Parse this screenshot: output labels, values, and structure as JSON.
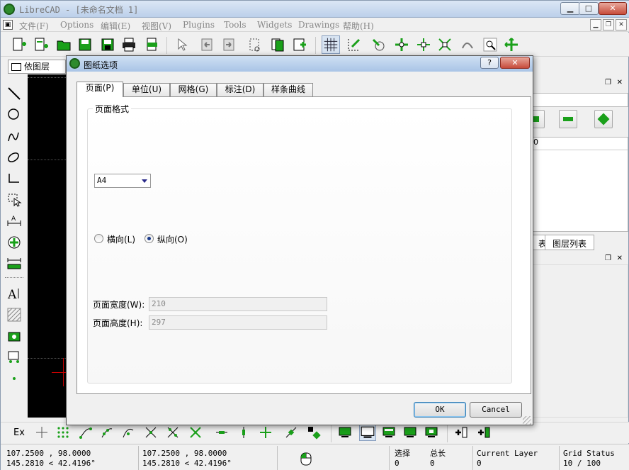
{
  "app": {
    "title": "LibreCAD - [未命名文档 1]"
  },
  "menu": {
    "items": [
      {
        "label": "文件(F)"
      },
      {
        "label": "Options"
      },
      {
        "label": "编辑(E)"
      },
      {
        "label": "视图(V)"
      },
      {
        "label": "Plugins"
      },
      {
        "label": "Tools"
      },
      {
        "label": "Widgets"
      },
      {
        "label": "Drawings"
      },
      {
        "label": "帮助(H)"
      }
    ]
  },
  "layer_toolbar": {
    "current_layer": "依图层"
  },
  "dialog": {
    "title": "图纸选项",
    "help_btn": "?",
    "close_btn": "✕",
    "tabs": [
      {
        "label": "页面(P)",
        "active": true
      },
      {
        "label": "单位(U)",
        "active": false
      },
      {
        "label": "网格(G)",
        "active": false
      },
      {
        "label": "标注(D)",
        "active": false
      },
      {
        "label": "样条曲线",
        "active": false
      }
    ],
    "page_format": {
      "group_label": "页面格式",
      "paper_size": "A4",
      "orientation": {
        "landscape_label": "横向(L)",
        "portrait_label": "纵向(O)",
        "selected": "portrait"
      },
      "width_label": "页面宽度(W):",
      "width_value": "210",
      "height_label": "页面高度(H):",
      "height_value": "297"
    },
    "ok_label": "OK",
    "cancel_label": "Cancel"
  },
  "right_dock": {
    "tabs": [
      {
        "label": "表"
      },
      {
        "label": "图层列表"
      }
    ]
  },
  "bottom_bar": {
    "ex_label": "Ex"
  },
  "status": {
    "abs_coord_1": "107.2500 , 98.0000",
    "abs_coord_2": "145.2810 < 42.4196°",
    "rel_coord_1": "107.2500 , 98.0000",
    "rel_coord_2": "145.2810 < 42.4196°",
    "selected_label": "选择",
    "selected_value": "0",
    "total_label": "总长",
    "total_value": "0",
    "current_layer_label": "Current Layer",
    "current_layer_value": "0",
    "grid_status_label": "Grid Status",
    "grid_status_value": "10 / 100"
  },
  "colors": {
    "accent_green": "#2e8b2e",
    "canvas_bg": "#000000"
  }
}
